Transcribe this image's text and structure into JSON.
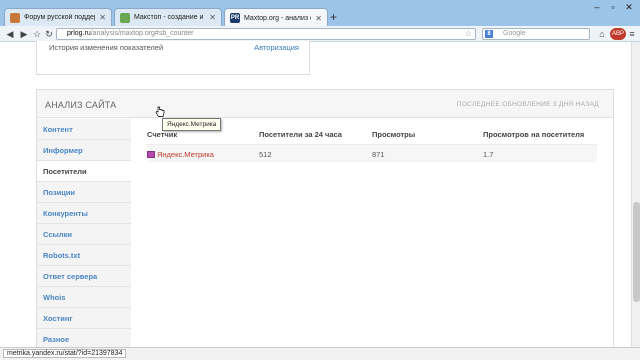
{
  "browser": {
    "tabs": [
      {
        "label": "Форум русской поддержк...",
        "color": "#c8783a"
      },
      {
        "label": "Макстоп - создание и раз...",
        "color": "#6aa84f"
      },
      {
        "label": "Maxtop.org - анализ сайта...",
        "color": "#1a3b6a"
      }
    ],
    "new_tab": "+",
    "url_host": "prlog.ru",
    "url_path": "/analysis/maxtop.org#sb_counter",
    "search_engine_icon": "8",
    "search_placeholder": "Google"
  },
  "top_panel": {
    "history_label": "История изменения показателей",
    "auth_link": "Авторизация"
  },
  "analysis": {
    "title": "АНАЛИЗ САЙТА",
    "updated": "ПОСЛЕДНЕЕ ОБНОВЛЕНИЕ 3 ДНЯ НАЗАД",
    "sidebar": [
      "Контент",
      "Информер",
      "Посетители",
      "Позиции",
      "Конкуренты",
      "Ссылки",
      "Robots.txt",
      "Ответ сервера",
      "Whois",
      "Хостинг",
      "Разное"
    ],
    "active_index": 2,
    "table": {
      "headers": [
        "Счетчик",
        "Посетители за 24 часа",
        "Просмотры",
        "Просмотров на посетителя"
      ],
      "rows": [
        {
          "counter": "Яндекс.Метрика",
          "visitors": "512",
          "views": "871",
          "views_per_visitor": "1.7"
        }
      ]
    },
    "tooltip": "Яндекс.Метрика"
  },
  "status": {
    "url": "metrika.yandex.ru/stat/?id=21397834"
  }
}
